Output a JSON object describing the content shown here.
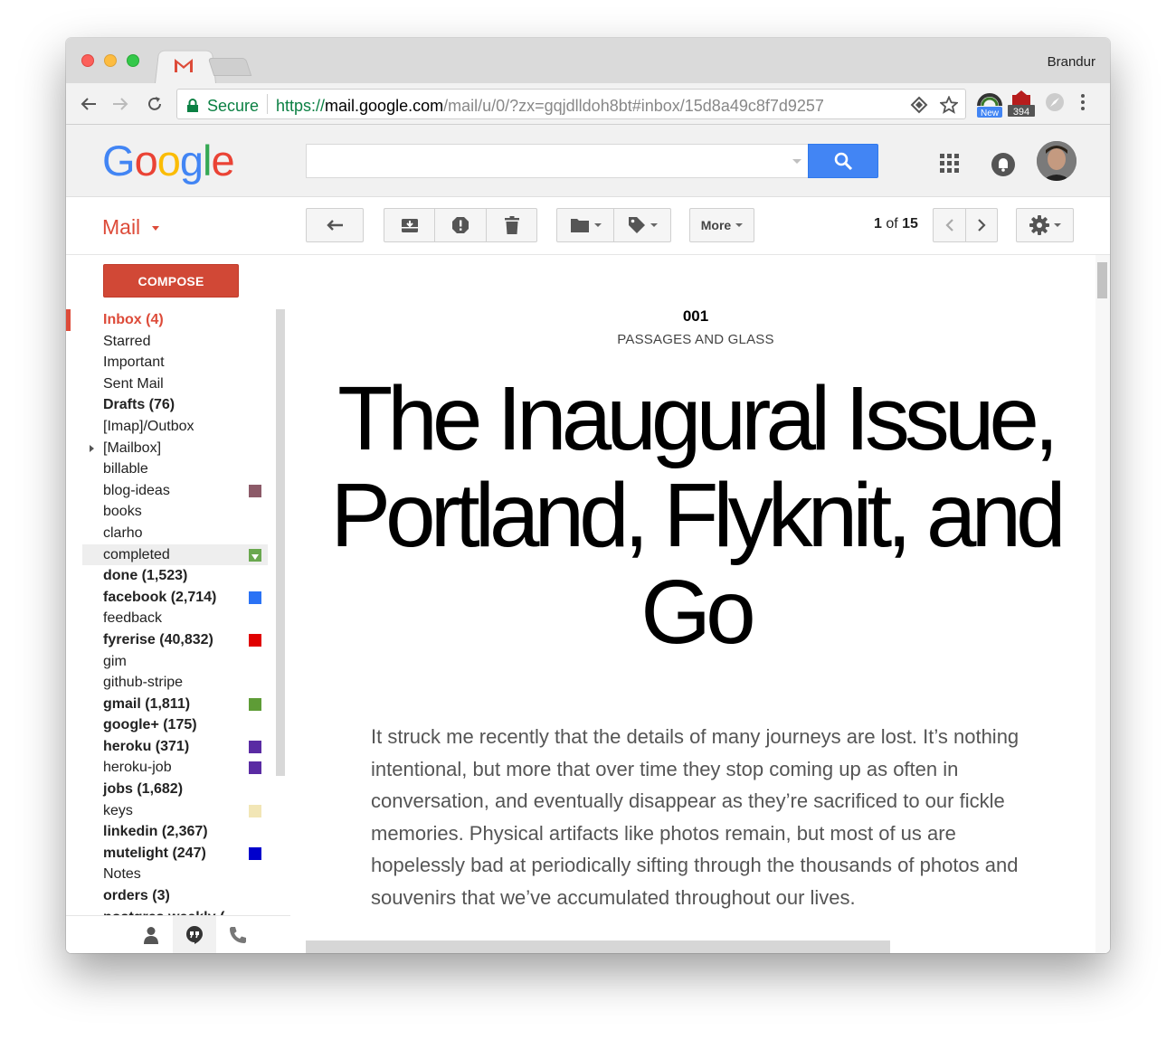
{
  "browser": {
    "profile_name": "Brandur",
    "secure_label": "Secure",
    "url_scheme": "https://",
    "url_host": "mail.google.com",
    "url_path": "/mail/u/0/?zx=gqjdlldoh8bt#inbox/15d8a49c8f7d9257",
    "extensions": [
      {
        "name": "new-extension-icon",
        "badge": "New"
      },
      {
        "name": "hn-extension-icon",
        "badge": "394"
      }
    ]
  },
  "gmail": {
    "logo_text": "Google",
    "mail_label": "Mail",
    "compose_label": "COMPOSE",
    "more_label": "More",
    "pager": {
      "current": "1",
      "separator": "of",
      "total": "15"
    },
    "colors": {
      "accent": "#dd4b39",
      "compose": "#d14836",
      "search": "#4285f4"
    }
  },
  "sidebar": {
    "labels": [
      {
        "text": "Inbox (4)",
        "style": "inbox"
      },
      {
        "text": "Starred",
        "style": ""
      },
      {
        "text": "Important",
        "style": ""
      },
      {
        "text": "Sent Mail",
        "style": ""
      },
      {
        "text": "Drafts (76)",
        "style": "bold"
      },
      {
        "text": "[Imap]/Outbox",
        "style": ""
      },
      {
        "text": "[Mailbox]",
        "style": "",
        "expander": true
      },
      {
        "text": "billable",
        "style": ""
      },
      {
        "text": "blog-ideas",
        "style": "",
        "color": "#8c5a68"
      },
      {
        "text": "books",
        "style": ""
      },
      {
        "text": "clarho",
        "style": ""
      },
      {
        "text": "completed",
        "style": "hover",
        "color": "#6aa84f",
        "check": true
      },
      {
        "text": "done (1,523)",
        "style": "bold"
      },
      {
        "text": "facebook (2,714)",
        "style": "bold",
        "color": "#2a72f5"
      },
      {
        "text": "feedback",
        "style": ""
      },
      {
        "text": "fyrerise (40,832)",
        "style": "bold",
        "color": "#e00000"
      },
      {
        "text": "gim",
        "style": ""
      },
      {
        "text": "github-stripe",
        "style": ""
      },
      {
        "text": "gmail (1,811)",
        "style": "bold",
        "color": "#5e9c36"
      },
      {
        "text": "google+ (175)",
        "style": "bold"
      },
      {
        "text": "heroku (371)",
        "style": "bold",
        "color": "#5a2ba3"
      },
      {
        "text": "heroku-job",
        "style": "",
        "color": "#5a2ba3"
      },
      {
        "text": "jobs (1,682)",
        "style": "bold"
      },
      {
        "text": "keys",
        "style": "",
        "color": "#f2e6b6"
      },
      {
        "text": "linkedin (2,367)",
        "style": "bold"
      },
      {
        "text": "mutelight (247)",
        "style": "bold",
        "color": "#0000cc"
      },
      {
        "text": "Notes",
        "style": ""
      },
      {
        "text": "orders (3)",
        "style": "bold"
      },
      {
        "text": "postgres weekly (",
        "style": "bold"
      }
    ]
  },
  "message": {
    "issue_number": "001",
    "issue_kicker": "PASSAGES AND GLASS",
    "headline": "The Inaugural Issue, Portland, Flyknit, and Go",
    "body": "It struck me recently that the details of many journeys are lost. It’s nothing intentional, but more that over time they stop coming up as often in conversation, and eventually disappear as they’re sacrificed to our fickle memories. Physical artifacts like photos remain, but most of us are hopelessly bad at periodically sifting through the thousands of photos and souvenirs that we’ve accumulated throughout our lives."
  }
}
